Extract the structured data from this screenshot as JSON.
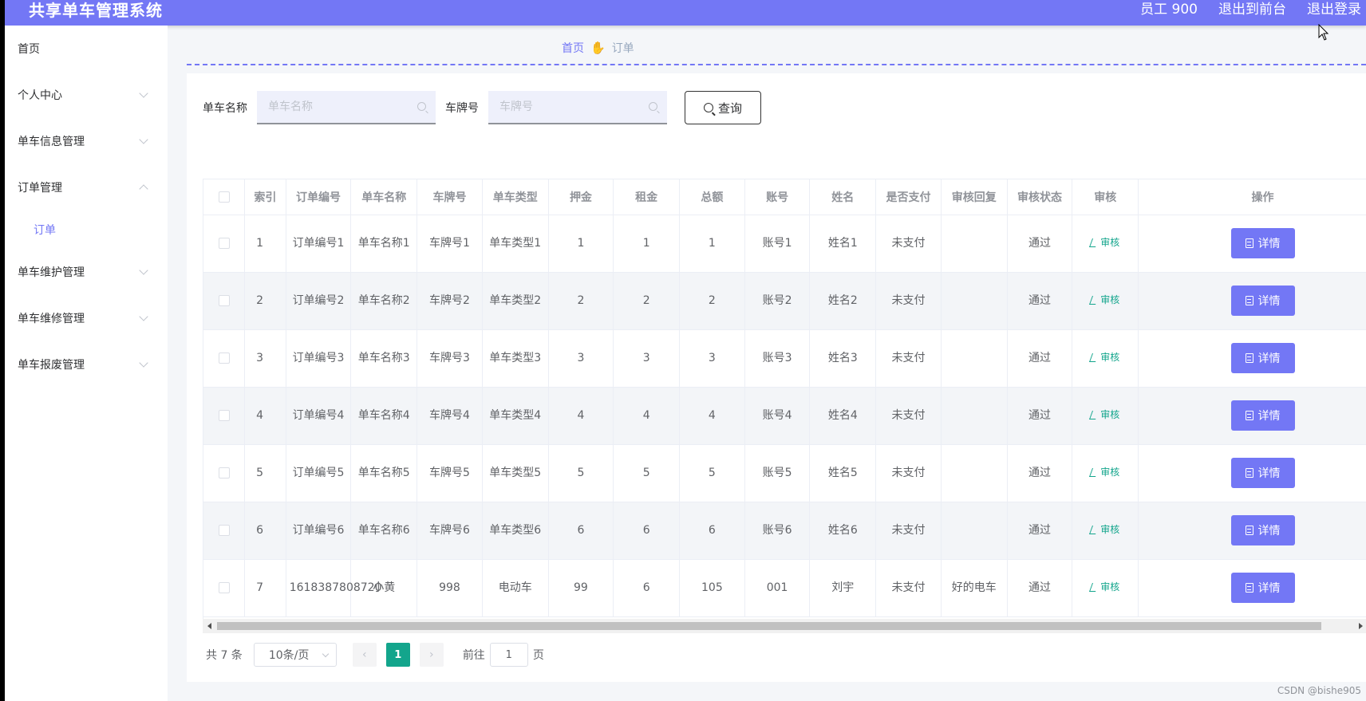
{
  "header": {
    "title": "共享单车管理系统",
    "user": "员工 900",
    "to_front": "退出到前台",
    "logout": "退出登录"
  },
  "sidebar": {
    "items": [
      {
        "label": "首页",
        "expandable": false
      },
      {
        "label": "个人中心",
        "expandable": true
      },
      {
        "label": "单车信息管理",
        "expandable": true
      },
      {
        "label": "订单管理",
        "expandable": true,
        "expanded": true
      },
      {
        "label": "单车维护管理",
        "expandable": true
      },
      {
        "label": "单车维修管理",
        "expandable": true
      },
      {
        "label": "单车报废管理",
        "expandable": true
      }
    ],
    "active_sub": "订单"
  },
  "breadcrumb": {
    "home": "首页",
    "separator_icon": "hand-icon",
    "current": "订单"
  },
  "search": {
    "bike_name_label": "单车名称",
    "bike_name_placeholder": "单车名称",
    "plate_label": "车牌号",
    "plate_placeholder": "车牌号",
    "query_label": "查询"
  },
  "table": {
    "columns": [
      "索引",
      "订单编号",
      "单车名称",
      "车牌号",
      "单车类型",
      "押金",
      "租金",
      "总额",
      "账号",
      "姓名",
      "是否支付",
      "审核回复",
      "审核状态",
      "审核",
      "操作"
    ],
    "audit_label": "审核",
    "detail_label": "详情",
    "rows": [
      {
        "index": "1",
        "order_no": "订单编号1",
        "bike_name": "单车名称1",
        "plate": "车牌号1",
        "bike_type": "单车类型1",
        "deposit": "1",
        "rent": "1",
        "total": "1",
        "account": "账号1",
        "name": "姓名1",
        "paid": "未支付",
        "reply": "",
        "status": "通过"
      },
      {
        "index": "2",
        "order_no": "订单编号2",
        "bike_name": "单车名称2",
        "plate": "车牌号2",
        "bike_type": "单车类型2",
        "deposit": "2",
        "rent": "2",
        "total": "2",
        "account": "账号2",
        "name": "姓名2",
        "paid": "未支付",
        "reply": "",
        "status": "通过"
      },
      {
        "index": "3",
        "order_no": "订单编号3",
        "bike_name": "单车名称3",
        "plate": "车牌号3",
        "bike_type": "单车类型3",
        "deposit": "3",
        "rent": "3",
        "total": "3",
        "account": "账号3",
        "name": "姓名3",
        "paid": "未支付",
        "reply": "",
        "status": "通过"
      },
      {
        "index": "4",
        "order_no": "订单编号4",
        "bike_name": "单车名称4",
        "plate": "车牌号4",
        "bike_type": "单车类型4",
        "deposit": "4",
        "rent": "4",
        "total": "4",
        "account": "账号4",
        "name": "姓名4",
        "paid": "未支付",
        "reply": "",
        "status": "通过"
      },
      {
        "index": "5",
        "order_no": "订单编号5",
        "bike_name": "单车名称5",
        "plate": "车牌号5",
        "bike_type": "单车类型5",
        "deposit": "5",
        "rent": "5",
        "total": "5",
        "account": "账号5",
        "name": "姓名5",
        "paid": "未支付",
        "reply": "",
        "status": "通过"
      },
      {
        "index": "6",
        "order_no": "订单编号6",
        "bike_name": "单车名称6",
        "plate": "车牌号6",
        "bike_type": "单车类型6",
        "deposit": "6",
        "rent": "6",
        "total": "6",
        "account": "账号6",
        "name": "姓名6",
        "paid": "未支付",
        "reply": "",
        "status": "通过"
      },
      {
        "index": "7",
        "order_no": "1618387808720",
        "bike_name": "小黄",
        "plate": "998",
        "bike_type": "电动车",
        "deposit": "99",
        "rent": "6",
        "total": "105",
        "account": "001",
        "name": "刘宇",
        "paid": "未支付",
        "reply": "好的电车",
        "status": "通过"
      }
    ]
  },
  "pagination": {
    "total": "共 7 条",
    "page_size": "10条/页",
    "current_page": "1",
    "goto_label": "前往",
    "goto_value": "1",
    "page_unit": "页"
  },
  "watermark": "CSDN @bishe905",
  "colors": {
    "accent": "#7377f5",
    "success": "#13a58c"
  }
}
